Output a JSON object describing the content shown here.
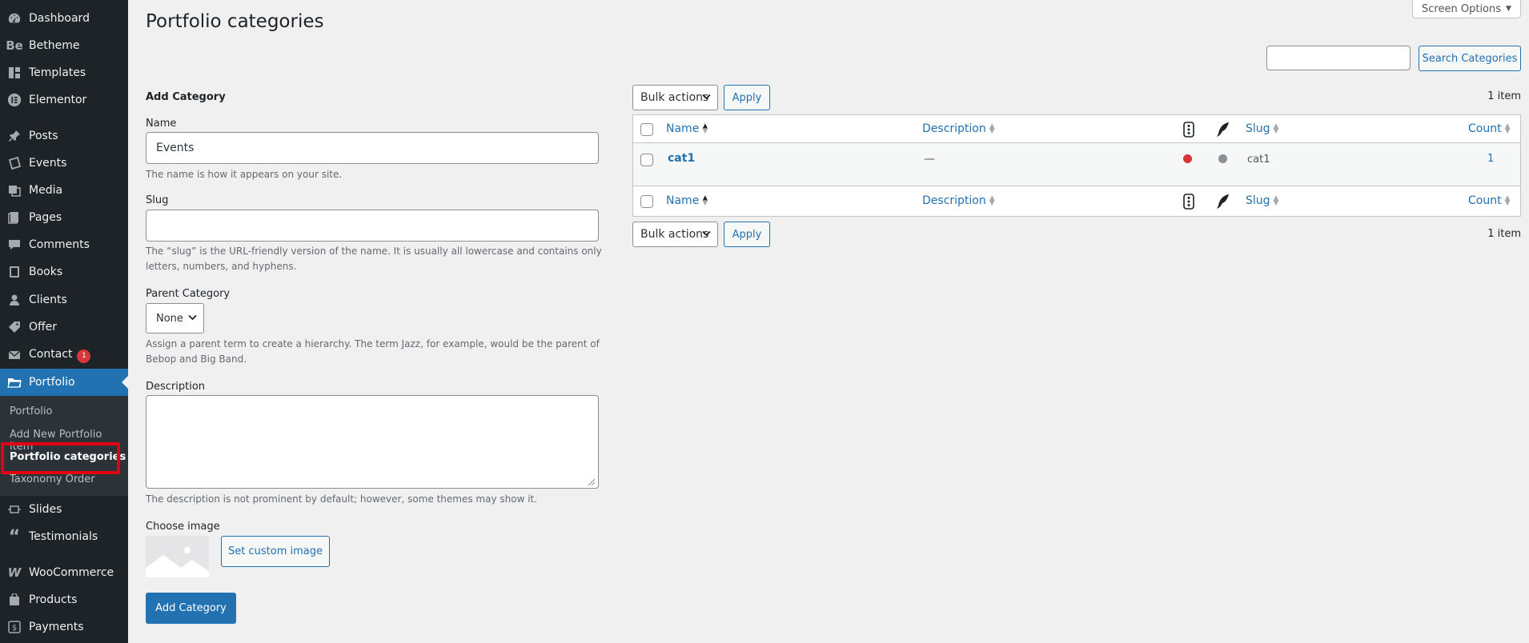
{
  "sidebar": {
    "items": [
      {
        "label": "Dashboard",
        "icon": "dashboard-icon"
      },
      {
        "label": "Betheme",
        "icon": "betheme-icon"
      },
      {
        "label": "Templates",
        "icon": "templates-icon"
      },
      {
        "label": "Elementor",
        "icon": "elementor-icon"
      },
      {
        "label": "Posts",
        "icon": "pin-icon"
      },
      {
        "label": "Events",
        "icon": "events-icon"
      },
      {
        "label": "Media",
        "icon": "media-icon"
      },
      {
        "label": "Pages",
        "icon": "pages-icon"
      },
      {
        "label": "Comments",
        "icon": "comments-icon"
      },
      {
        "label": "Books",
        "icon": "books-icon"
      },
      {
        "label": "Clients",
        "icon": "clients-icon"
      },
      {
        "label": "Offer",
        "icon": "tag-icon"
      },
      {
        "label": "Contact",
        "icon": "mail-icon",
        "badge": "1"
      },
      {
        "label": "Portfolio",
        "icon": "folder-icon"
      },
      {
        "label": "Slides",
        "icon": "slides-icon"
      },
      {
        "label": "Testimonials",
        "icon": "quote-icon"
      },
      {
        "label": "WooCommerce",
        "icon": "woocommerce-icon"
      },
      {
        "label": "Products",
        "icon": "products-icon"
      },
      {
        "label": "Payments",
        "icon": "payments-icon"
      }
    ],
    "submenu": [
      "Portfolio",
      "Add New Portfolio item",
      "Portfolio categories",
      "Taxonomy Order"
    ]
  },
  "page": {
    "title": "Portfolio categories",
    "screen_options": "Screen Options",
    "search_button": "Search Categories",
    "search_value": ""
  },
  "form": {
    "heading": "Add Category",
    "name_label": "Name",
    "name_value": "Events",
    "name_desc": "The name is how it appears on your site.",
    "slug_label": "Slug",
    "slug_value": "",
    "slug_desc_1": "The “slug” is the URL-friendly version of the name. It is usually all lowercase and contains only",
    "slug_desc_2": "letters, numbers, and hyphens.",
    "parent_label": "Parent Category",
    "parent_value": "None",
    "parent_desc_1": "Assign a parent term to create a hierarchy. The term Jazz, for example, would be the parent of",
    "parent_desc_2": "Bebop and Big Band.",
    "description_label": "Description",
    "description_value": "",
    "description_desc": "The description is not prominent by default; however, some themes may show it.",
    "image_label": "Choose image",
    "set_image_button": "Set custom image",
    "submit_button": "Add Category"
  },
  "table": {
    "bulk_actions": "Bulk actions",
    "apply": "Apply",
    "items_count": "1 item",
    "columns": {
      "name": "Name",
      "description": "Description",
      "slug": "Slug",
      "count": "Count"
    },
    "rows": [
      {
        "name": "cat1",
        "description": "—",
        "slug": "cat1",
        "count": "1"
      }
    ],
    "status_colors": {
      "red": "#d63638",
      "gray": "#8c8f94"
    }
  },
  "colors": {
    "accent": "#2271b1",
    "sidebar": "#1d2327",
    "highlight": "#e3000f"
  }
}
